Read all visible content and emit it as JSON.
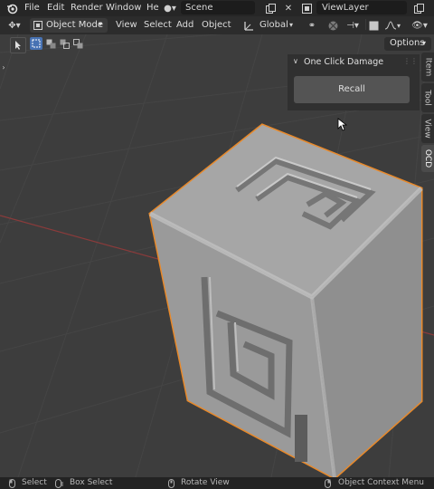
{
  "topbar": {
    "menus": [
      "File",
      "Edit",
      "Render",
      "Window",
      "He"
    ],
    "scene_label": "Scene",
    "viewlayer_label": "ViewLayer"
  },
  "toolbar": {
    "mode_label": "Object Mode",
    "menus": [
      "View",
      "Select",
      "Add",
      "Object"
    ],
    "orientation_label": "Global",
    "options_label": "Options"
  },
  "panel": {
    "title": "One Click Damage",
    "recall_label": "Recall"
  },
  "side_tabs": [
    "Item",
    "Tool",
    "View",
    "OCD"
  ],
  "statusbar": {
    "select_label": "Select",
    "box_select_label": "Box Select",
    "rotate_label": "Rotate View",
    "context_menu_label": "Object Context Menu"
  },
  "colors": {
    "selection_outline": "#e8892a",
    "accent_blue": "#4772b3",
    "axis_red": "#8a3b3b",
    "mesh_gray": "#a9a9a9"
  }
}
